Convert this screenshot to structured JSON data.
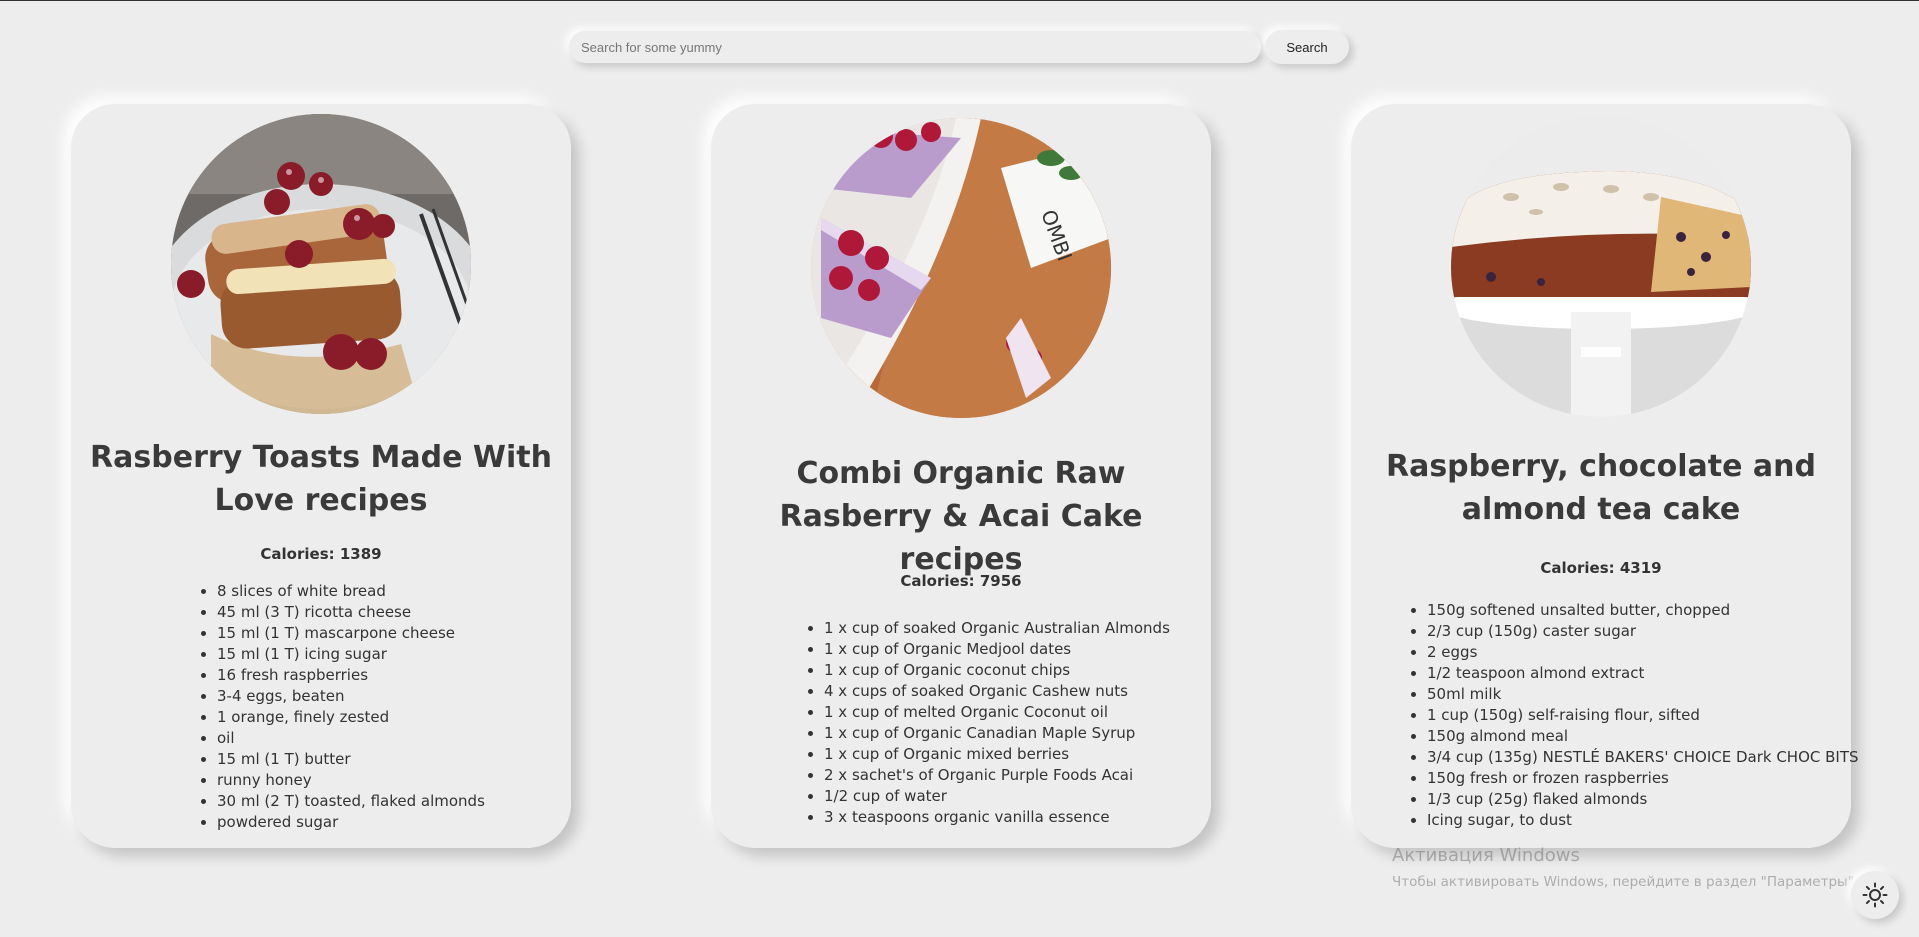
{
  "search": {
    "placeholder": "Search for some yummy",
    "button_label": "Search"
  },
  "recipes": [
    {
      "title": "Rasberry Toasts Made With Love recipes",
      "calories_label": "Calories: 1389",
      "ingredients": [
        "8 slices of white bread",
        "45 ml (3 T) ricotta cheese",
        "15 ml (1 T) mascarpone cheese",
        "15 ml (1 T) icing sugar",
        "16 fresh raspberries",
        "3-4 eggs, beaten",
        "1 orange, finely zested",
        "oil",
        "15 ml (1 T) butter",
        "runny honey",
        "30 ml (2 T) toasted, flaked almonds",
        "powdered sugar"
      ]
    },
    {
      "title": "Combi Organic Raw Rasberry & Acai Cake recipes",
      "calories_label": "Calories: 7956",
      "ingredients": [
        "1 x cup of soaked Organic Australian Almonds",
        "1 x cup of Organic Medjool dates",
        "1 x cup of Organic coconut chips",
        "4 x cups of soaked Organic Cashew nuts",
        "1 x cup of melted Organic Coconut oil",
        "1 x cup of Organic Canadian Maple Syrup",
        "1 x cup of Organic mixed berries",
        "2 x sachet's of Organic Purple Foods Acai",
        "1/2 cup of water",
        "3 x teaspoons organic vanilla essence"
      ]
    },
    {
      "title": "Raspberry, chocolate and almond tea cake",
      "calories_label": "Calories: 4319",
      "ingredients": [
        "150g softened unsalted butter, chopped",
        "2/3 cup (150g) caster sugar",
        "2 eggs",
        "1/2 teaspoon almond extract",
        "50ml milk",
        "1 cup (150g) self-raising flour, sifted",
        "150g almond meal",
        "3/4 cup (135g) NESTLÉ BAKERS' CHOICE Dark CHOC BITS",
        "150g fresh or frozen raspberries",
        "1/3 cup (25g) flaked almonds",
        "Icing sugar, to dust"
      ]
    }
  ],
  "watermark": {
    "title": "Активация Windows",
    "text": "Чтобы активировать Windows, перейдите в раздел \"Параметры\"."
  },
  "theme_toggle": {
    "icon": "sun-icon"
  }
}
